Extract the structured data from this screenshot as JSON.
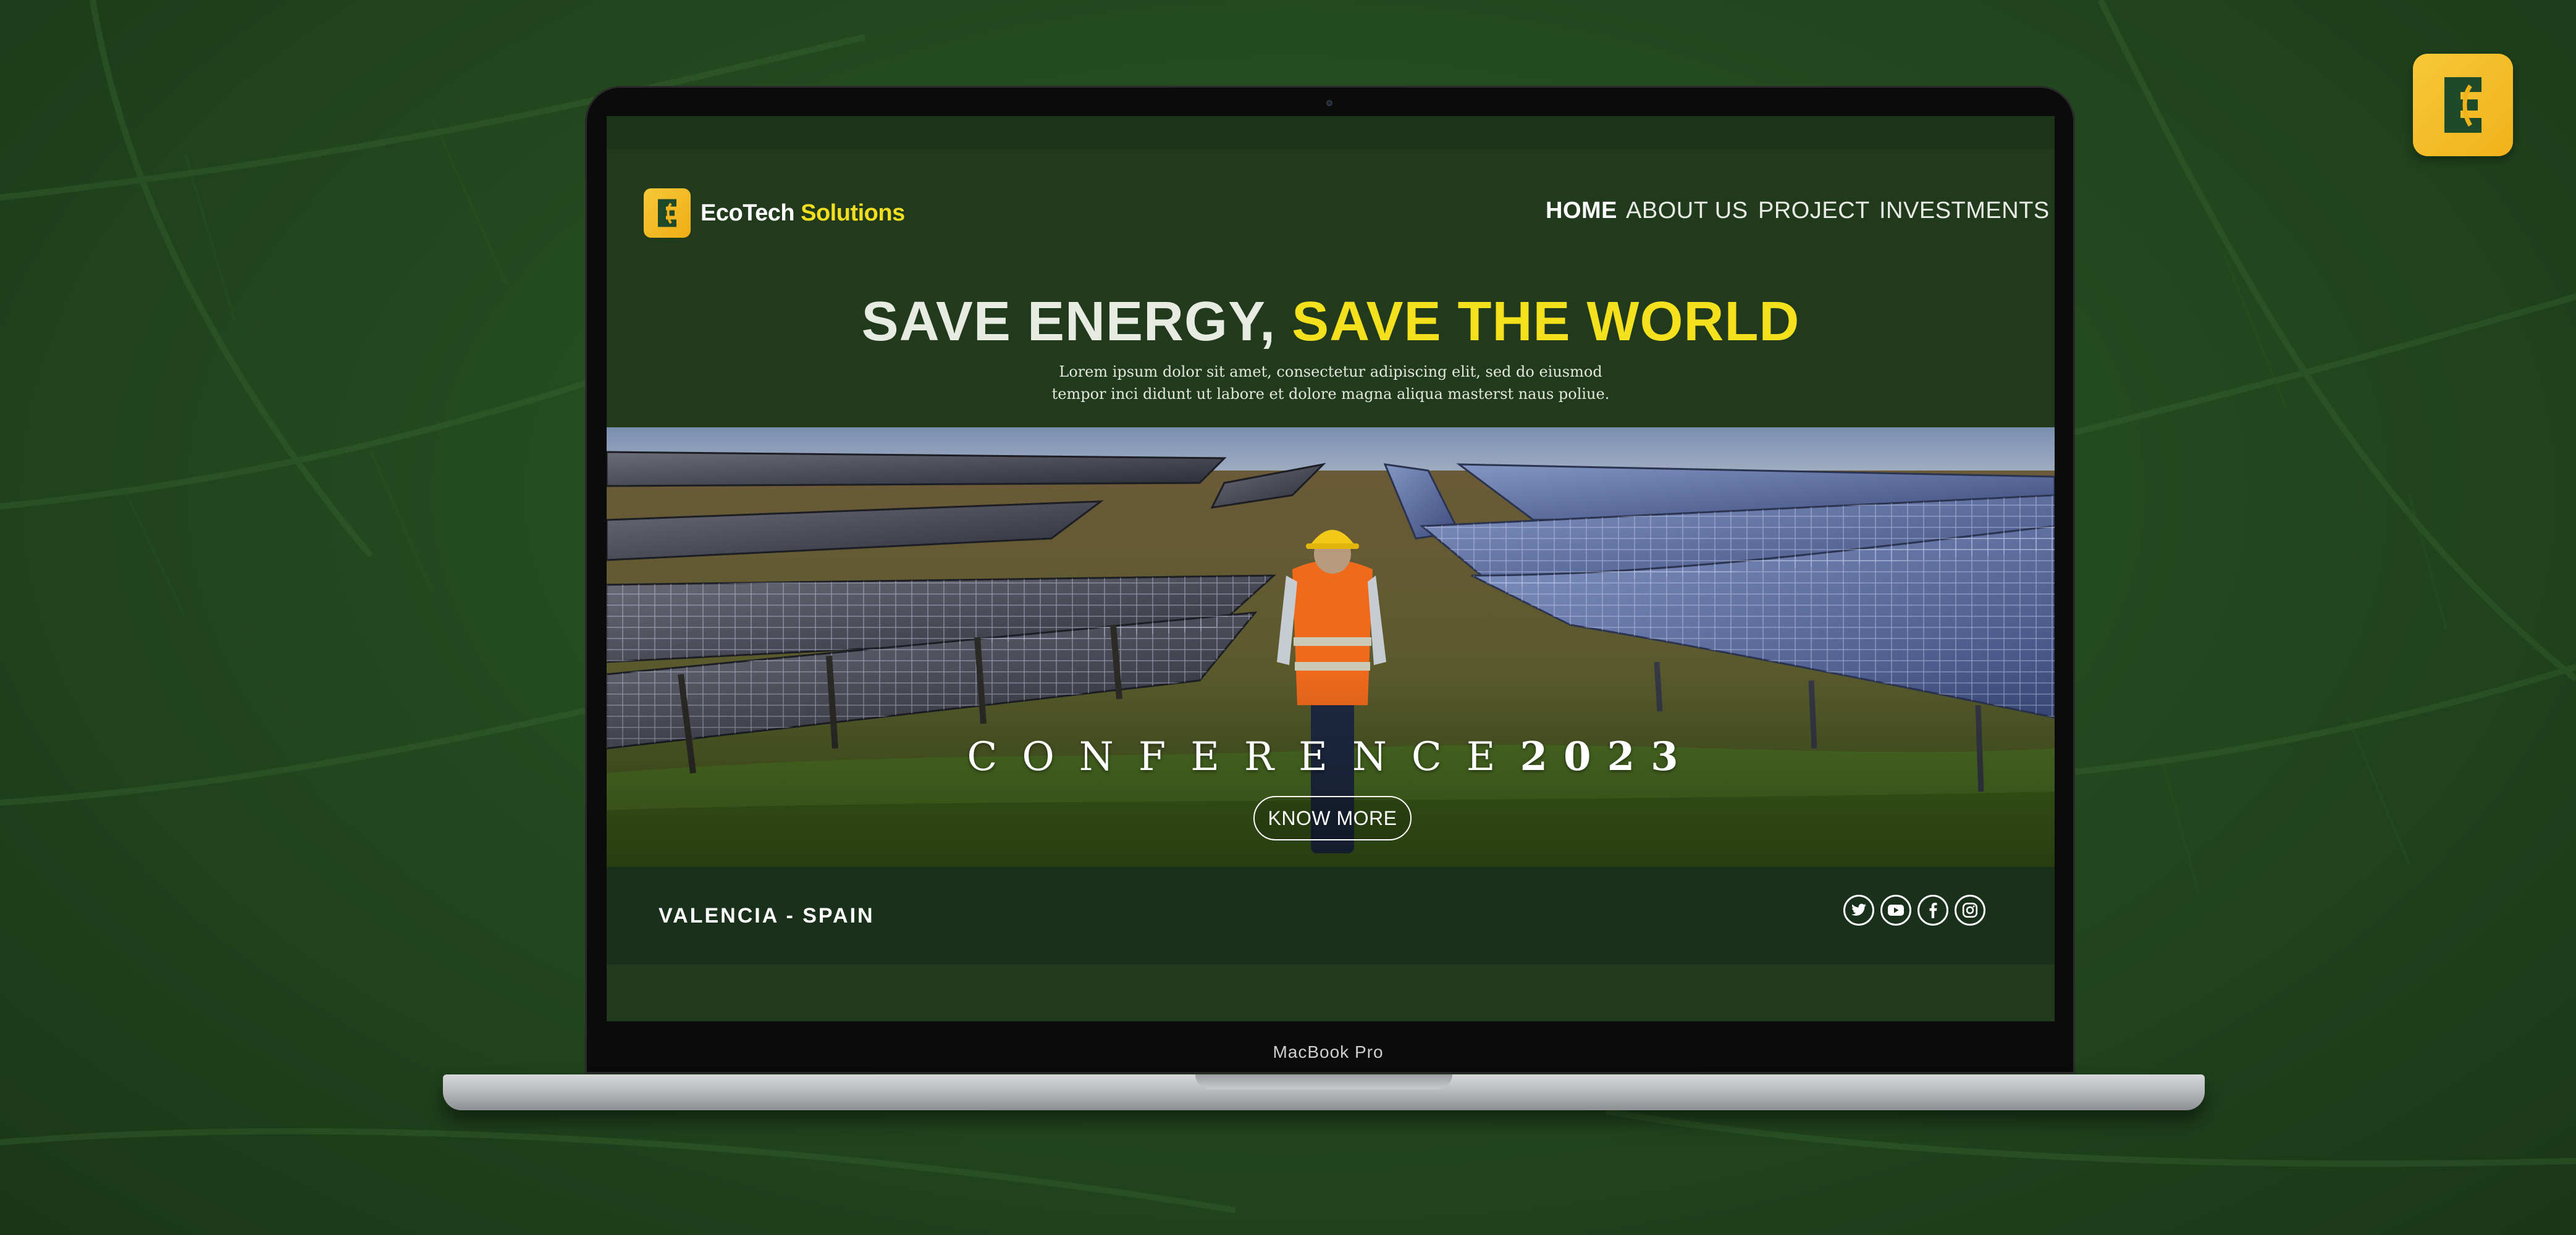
{
  "colors": {
    "background": "#244a20",
    "screen_bg": "#213a1c",
    "accent_yellow": "#f4e01c",
    "badge_gold": "#f2b21a",
    "footer_bg": "#19301a"
  },
  "brand": {
    "name_part1": "EcoTech",
    "name_part2": " Solutions",
    "logo_icon": "ecotech-e-leaf-icon"
  },
  "device": {
    "label": "MacBook Pro"
  },
  "nav": {
    "items": [
      {
        "label": "HOME",
        "active": true
      },
      {
        "label": "ABOUT US",
        "active": false
      },
      {
        "label": "PROJECT",
        "active": false
      },
      {
        "label": "INVESTMENTS",
        "active": false
      }
    ]
  },
  "hero": {
    "title_part1": "SAVE ENERGY,",
    "title_part2": " SAVE THE WORLD",
    "subtitle_line1": "Lorem ipsum dolor sit amet, consectetur adipiscing elit, sed do eiusmod",
    "subtitle_line2": "tempor inci didunt ut labore et dolore magna aliqua masterst naus poliue."
  },
  "banner": {
    "image": "worker-in-solar-panel-field-photo",
    "conference_word": "CONFERENCE",
    "conference_year": "2023",
    "cta_label": "KNOW MORE"
  },
  "footer": {
    "location": "VALENCIA - SPAIN",
    "socials": [
      "twitter-icon",
      "youtube-icon",
      "facebook-icon",
      "instagram-icon"
    ]
  }
}
